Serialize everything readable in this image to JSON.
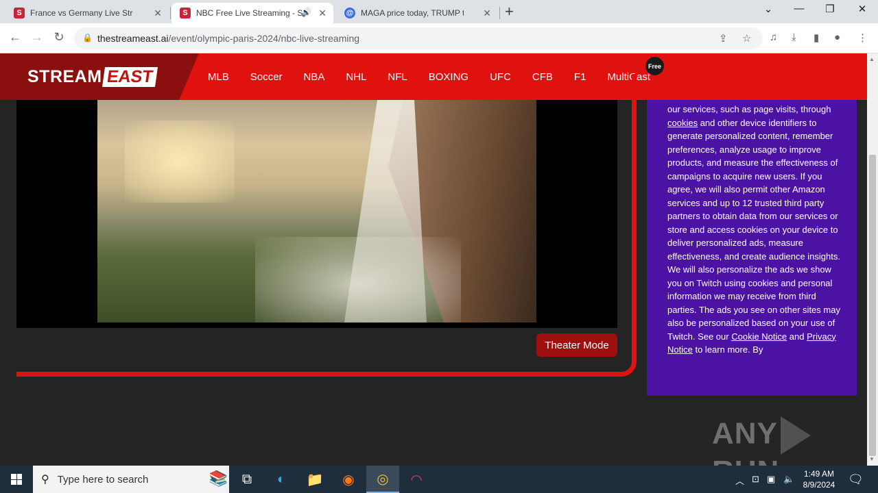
{
  "browser": {
    "tabs": [
      {
        "title": "France vs Germany Live Streamin",
        "favicon": "S",
        "favicon_color": "#c3253b"
      },
      {
        "title": "NBC Free Live Streaming - S",
        "favicon": "S",
        "favicon_color": "#c3253b",
        "audio_icon": "speaker-icon"
      },
      {
        "title": "MAGA price today, TRUMP to US",
        "favicon": "@",
        "favicon_color": "#3b6fe0"
      }
    ],
    "new_tab": "+",
    "url_host": "thestreameast.ai",
    "url_path": "/event/olympic-paris-2024/nbc-live-streaming"
  },
  "site": {
    "logo_part1": "STREAM",
    "logo_part2": "EAST",
    "nav": [
      "MLB",
      "Soccer",
      "NBA",
      "NHL",
      "NFL",
      "BOXING",
      "UFC",
      "CFB",
      "F1",
      "MultiCast"
    ],
    "free_badge": "Free",
    "theater_button": "Theater Mode",
    "brand_color": "#e0120f"
  },
  "consent": {
    "text_1": "our services, such as page visits, through ",
    "link_cookies": "cookies",
    "text_2": " and other device identifiers to generate personalized content, remember preferences, analyze usage to improve products, and measure the effectiveness of campaigns to acquire new users. If you agree, we will also permit other Amazon services and up to 12 trusted third party partners to obtain data from our services or store and access cookies on your device to deliver personalized ads, measure effectiveness, and create audience insights. We will also personalize the ads we show you on Twitch using cookies and personal information we may receive from third parties. The ads you see on other sites may also be personalized based on your use of Twitch. See our ",
    "link_cookie_notice": "Cookie Notice",
    "text_3": " and ",
    "link_privacy": "Privacy Notice",
    "text_4": " to learn more. By"
  },
  "watermark": {
    "part1": "ANY",
    "part2": "RUN"
  },
  "taskbar": {
    "search_placeholder": "Type here to search",
    "time": "1:49 AM",
    "date": "8/9/2024"
  }
}
